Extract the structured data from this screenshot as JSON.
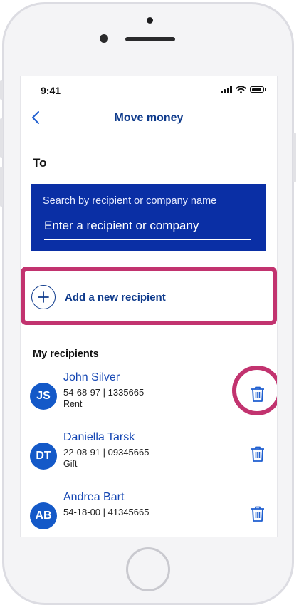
{
  "status_bar": {
    "time": "9:41"
  },
  "nav": {
    "title": "Move money"
  },
  "to_label": "To",
  "search": {
    "label": "Search by recipient or company name",
    "placeholder": "Enter a recipient or company"
  },
  "add_recipient": {
    "label": "Add a new recipient"
  },
  "recipients_section": {
    "title": "My recipients"
  },
  "recipients": [
    {
      "initials": "JS",
      "name": "John Silver",
      "account": "54-68-97 | 1335665",
      "reference": "Rent"
    },
    {
      "initials": "DT",
      "name": "Daniella Tarsk",
      "account": "22-08-91 | 09345665",
      "reference": "Gift"
    },
    {
      "initials": "AB",
      "name": "Andrea Bart",
      "account": "54-18-00 | 41345665",
      "reference": ""
    }
  ],
  "colors": {
    "brand_blue": "#0f3b8c",
    "search_bg": "#0a2fa5",
    "avatar_bg": "#1459c8",
    "highlight": "#c2336f"
  },
  "icons": {
    "back": "chevron-left-icon",
    "add": "plus-circle-icon",
    "delete": "trash-icon"
  }
}
